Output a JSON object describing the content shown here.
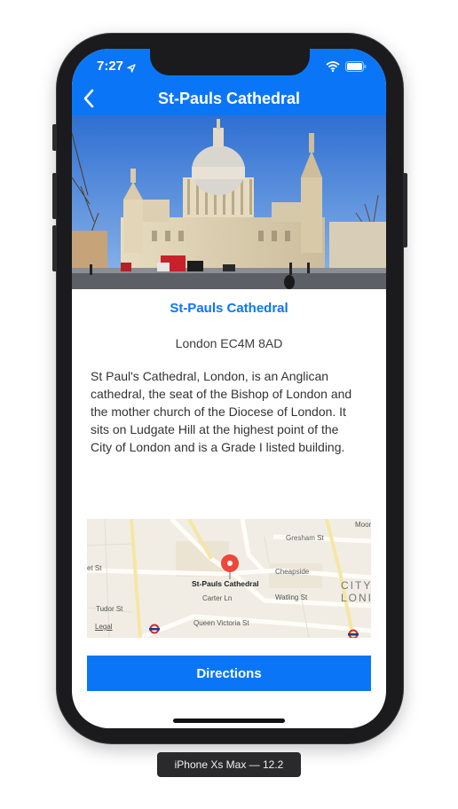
{
  "status": {
    "time": "7:27"
  },
  "nav": {
    "title": "St-Pauls Cathedral"
  },
  "place": {
    "title": "St-Pauls Cathedral",
    "address": "London EC4M 8AD",
    "description": "St Paul's Cathedral, London, is an Anglican cathedral, the seat of the Bishop of London and the mother church of the Diocese of London. It sits on Ludgate Hill at the highest point of the City of London and is a Grade I listed building."
  },
  "map": {
    "pin_label": "St-Pauls Cathedral",
    "street_labels": [
      "Gresham St",
      "Cheapside",
      "Watling St",
      "Carter Ln",
      "Tudor St",
      "Queen Victoria St",
      "et St",
      "Moorg"
    ],
    "area_label_1": "CITY",
    "area_label_2": "LONI",
    "legal": "Legal"
  },
  "actions": {
    "directions": "Directions"
  },
  "device_caption": "iPhone Xs Max — 12.2",
  "colors": {
    "accent": "#0a76f7",
    "pin": "#f0453a"
  }
}
